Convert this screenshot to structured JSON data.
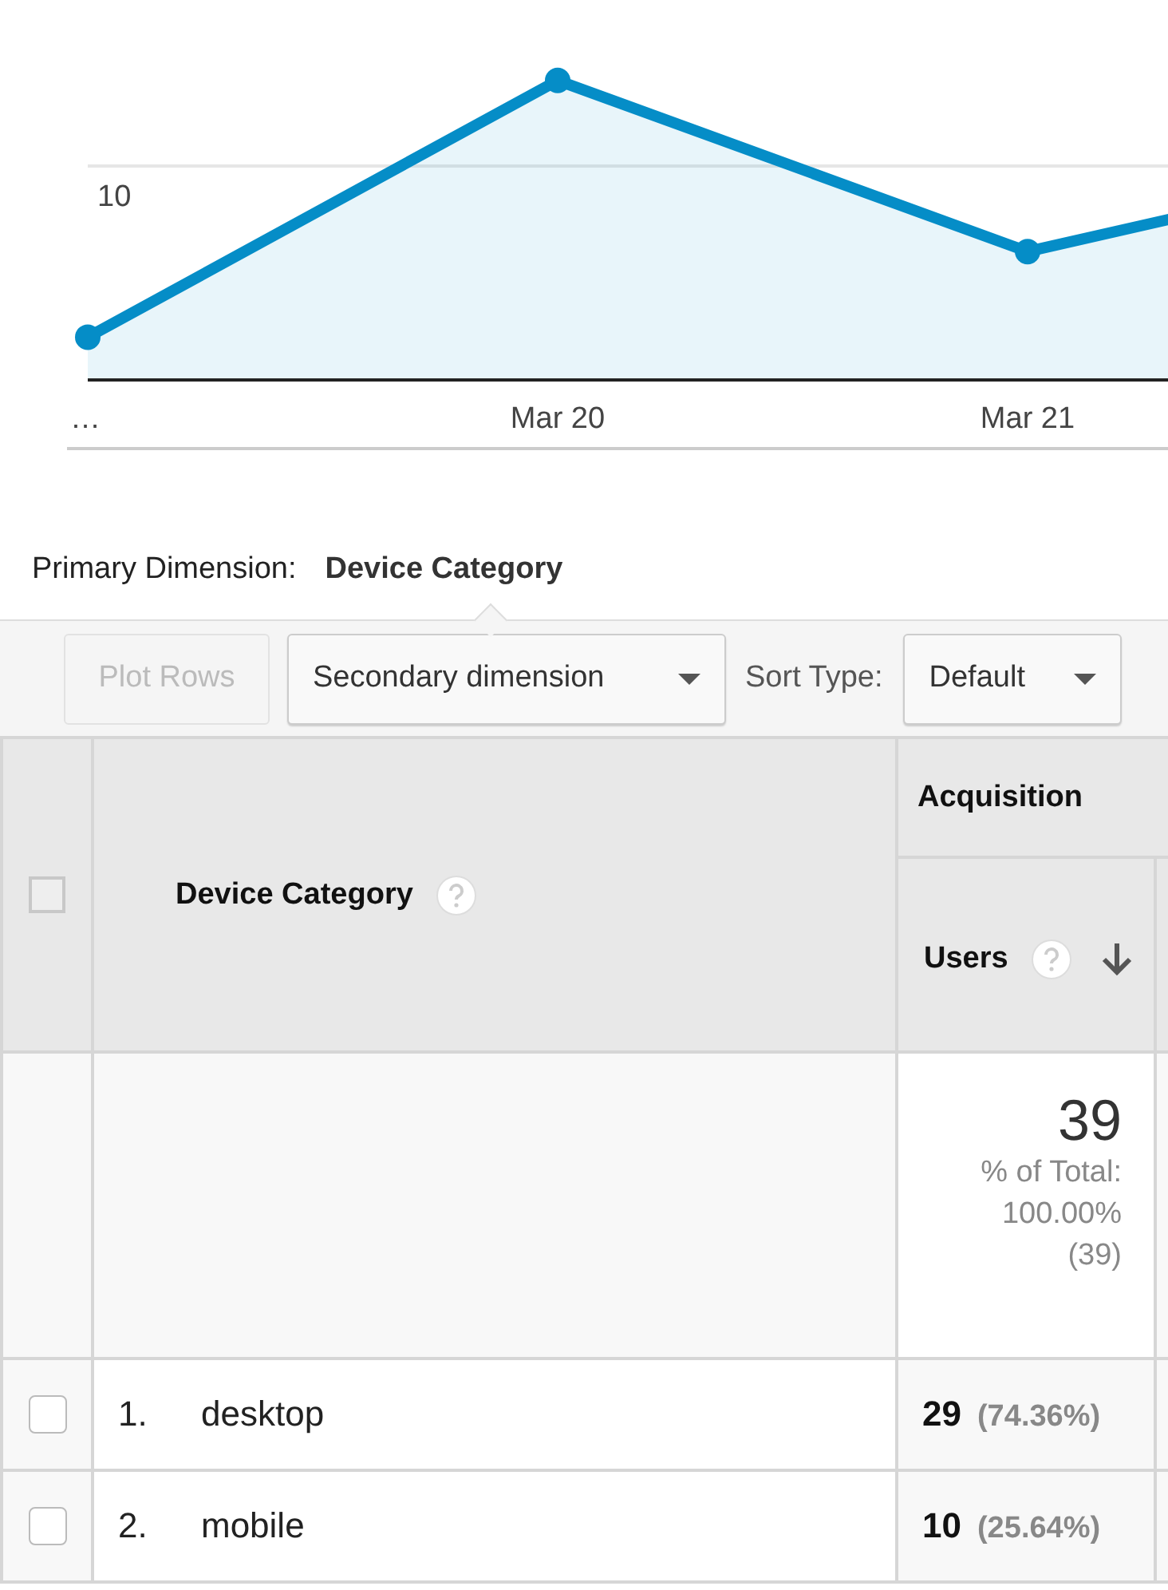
{
  "chart": {
    "kind": "area",
    "gridline_label": "10",
    "x_labels": [
      "…",
      "Mar 20",
      "Mar 21"
    ]
  },
  "primary_dimension": {
    "label": "Primary Dimension:",
    "value": "Device Category"
  },
  "toolbar": {
    "plot_rows": {
      "label": "Plot Rows",
      "disabled": true
    },
    "secondary_dimension": "Secondary dimension",
    "sort_label": "Sort Type:",
    "sort_value": "Default"
  },
  "table": {
    "select_all_checked": false,
    "dimension_header": "Device Category",
    "group_header": "Acquisition",
    "metric_header": "Users",
    "totals": {
      "value": "39",
      "lines": [
        "% of Total:",
        "100.00%",
        "(39)"
      ]
    },
    "rows": [
      {
        "index": "1.",
        "name": "desktop",
        "value": "29",
        "share": "(74.36%)",
        "checked": false
      },
      {
        "index": "2.",
        "name": "mobile",
        "value": "10",
        "share": "(25.64%)",
        "checked": false
      }
    ]
  }
}
